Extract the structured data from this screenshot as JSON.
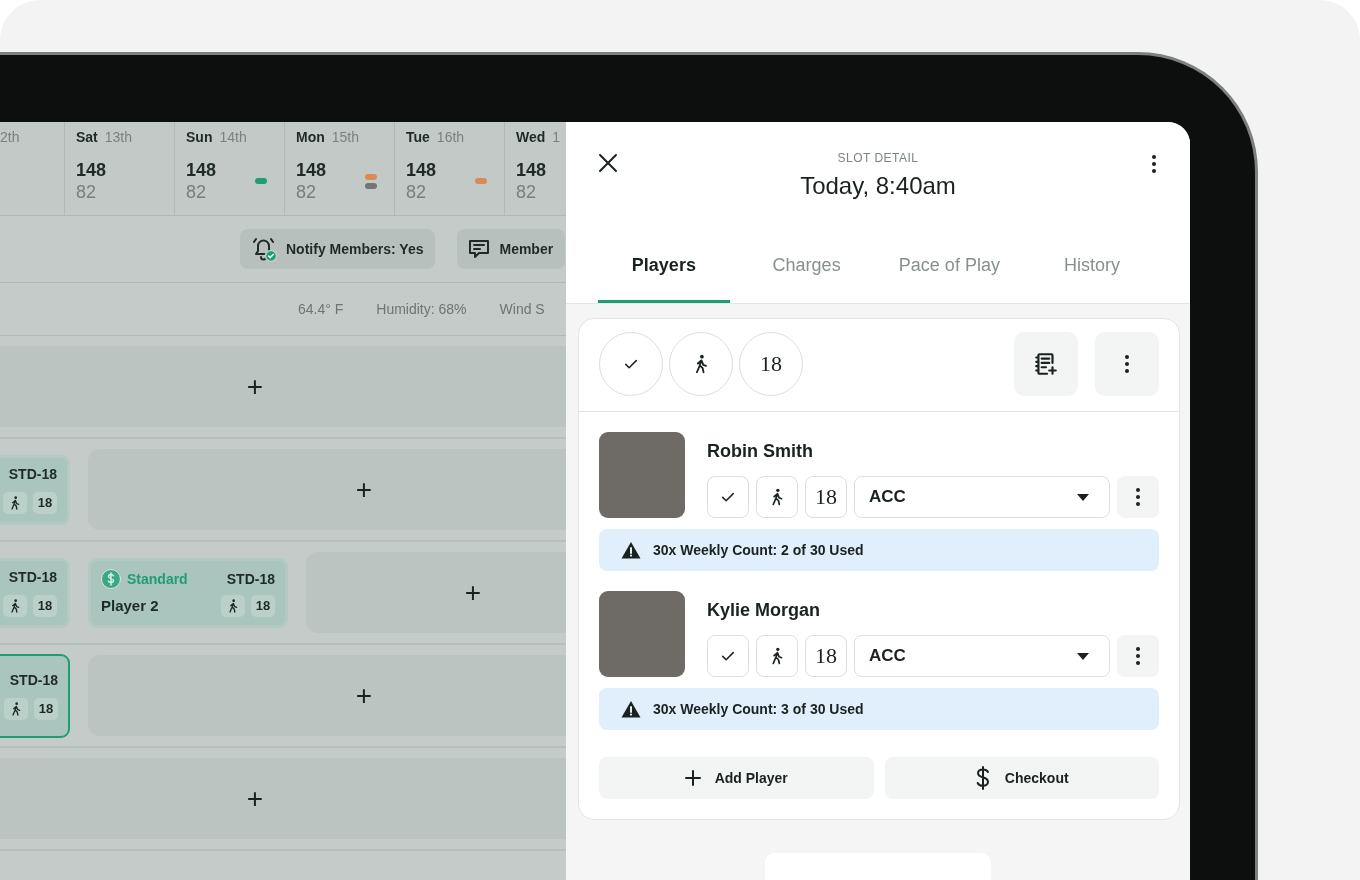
{
  "schedule": {
    "days": [
      {
        "date": "2th"
      },
      {
        "day": "Sat",
        "date": "13th",
        "booked": "148",
        "open": "82"
      },
      {
        "day": "Sun",
        "date": "14th",
        "booked": "148",
        "open": "82",
        "indicators": [
          {
            "color": "#1f9e74"
          }
        ]
      },
      {
        "day": "Mon",
        "date": "15th",
        "booked": "148",
        "open": "82",
        "indicators": [
          {
            "color": "#db8a55"
          },
          {
            "color": "#6f7876"
          }
        ]
      },
      {
        "day": "Tue",
        "date": "16th",
        "booked": "148",
        "open": "82",
        "indicators": [
          {
            "color": "#db8a55"
          }
        ]
      },
      {
        "day": "Wed",
        "date": "1",
        "booked": "148",
        "open": "82"
      }
    ],
    "toolbar": [
      {
        "kind": "notify",
        "label": "Notify Members: Yes"
      },
      {
        "kind": "message",
        "label": "Member"
      }
    ],
    "weather": [
      "64.4° F",
      "Humidity: 68%",
      "Wind S"
    ],
    "rows": [
      {
        "slots": [
          {
            "kind": "empty",
            "label": "+"
          }
        ]
      },
      {
        "slots": [
          {
            "kind": "booking",
            "code": "STD-18",
            "holes": "18",
            "selected": false
          },
          {
            "kind": "empty",
            "label": "+"
          }
        ]
      },
      {
        "slots": [
          {
            "kind": "booking",
            "code": "STD-18",
            "holes": "18",
            "selected": false
          },
          {
            "kind": "booking",
            "rate": "Standard",
            "code": "STD-18",
            "name": "Player 2",
            "holes": "18",
            "selected": false
          },
          {
            "kind": "empty",
            "label": "+"
          }
        ]
      },
      {
        "slots": [
          {
            "kind": "booking",
            "code": "STD-18",
            "holes": "18",
            "selected": true
          },
          {
            "kind": "empty",
            "label": "+"
          }
        ]
      },
      {
        "slots": [
          {
            "kind": "empty",
            "label": "+"
          }
        ]
      }
    ]
  },
  "detail": {
    "caption": "SLOT DETAIL",
    "title": "Today, 8:40am",
    "tabs": [
      {
        "label": "Players",
        "selected": true
      },
      {
        "label": "Charges",
        "selected": false
      },
      {
        "label": "Pace of Play",
        "selected": false
      },
      {
        "label": "History",
        "selected": false
      }
    ],
    "holes": "18",
    "players": [
      {
        "name": "Robin Smith",
        "holes": "18",
        "rate": "ACC",
        "notice": "30x Weekly Count: 2 of 30 Used"
      },
      {
        "name": "Kylie Morgan",
        "holes": "18",
        "rate": "ACC",
        "notice": "30x Weekly Count: 3 of 30 Used"
      }
    ],
    "actions": [
      {
        "kind": "add",
        "label": "Add Player"
      },
      {
        "kind": "checkout",
        "label": "Checkout"
      }
    ]
  }
}
